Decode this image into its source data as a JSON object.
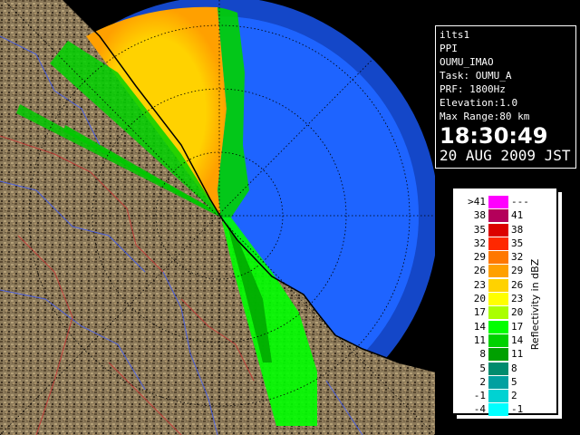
{
  "info": {
    "station": "ilts1",
    "scan_type": "PPI",
    "site": "OUMU_IMAO",
    "task": "Task: OUMU_A",
    "prf": "PRF: 1800Hz",
    "elevation": "Elevation:1.0",
    "max_range": "Max Range:80 km",
    "time": "18:30:49",
    "date": "20 AUG 2009 JST"
  },
  "legend": {
    "title": "Reflectivity in dBZ",
    "rows": [
      {
        "lo": ">41",
        "hi": "---",
        "color": "#ff00ff"
      },
      {
        "lo": "38",
        "hi": "41",
        "color": "#b4005a"
      },
      {
        "lo": "35",
        "hi": "38",
        "color": "#dc0000"
      },
      {
        "lo": "32",
        "hi": "35",
        "color": "#ff2800"
      },
      {
        "lo": "29",
        "hi": "32",
        "color": "#ff7800"
      },
      {
        "lo": "26",
        "hi": "29",
        "color": "#ffa000"
      },
      {
        "lo": "23",
        "hi": "26",
        "color": "#ffd200"
      },
      {
        "lo": "20",
        "hi": "23",
        "color": "#ffff00"
      },
      {
        "lo": "17",
        "hi": "20",
        "color": "#aaff00"
      },
      {
        "lo": "14",
        "hi": "17",
        "color": "#00ff00"
      },
      {
        "lo": "11",
        "hi": "14",
        "color": "#00d200"
      },
      {
        "lo": "8",
        "hi": "11",
        "color": "#00a000"
      },
      {
        "lo": "5",
        "hi": "8",
        "color": "#008c6e"
      },
      {
        "lo": "2",
        "hi": "5",
        "color": "#00a0a0"
      },
      {
        "lo": "-1",
        "hi": "2",
        "color": "#00d2d2"
      },
      {
        "lo": "-4",
        "hi": "-1",
        "color": "#00ffff"
      }
    ]
  },
  "map": {
    "sea_color": "#1e64ff",
    "outer_ring_color": "#1447c8",
    "land_color": "#8c7a5a",
    "coast_color": "#000000",
    "grid_color": "#000000"
  }
}
